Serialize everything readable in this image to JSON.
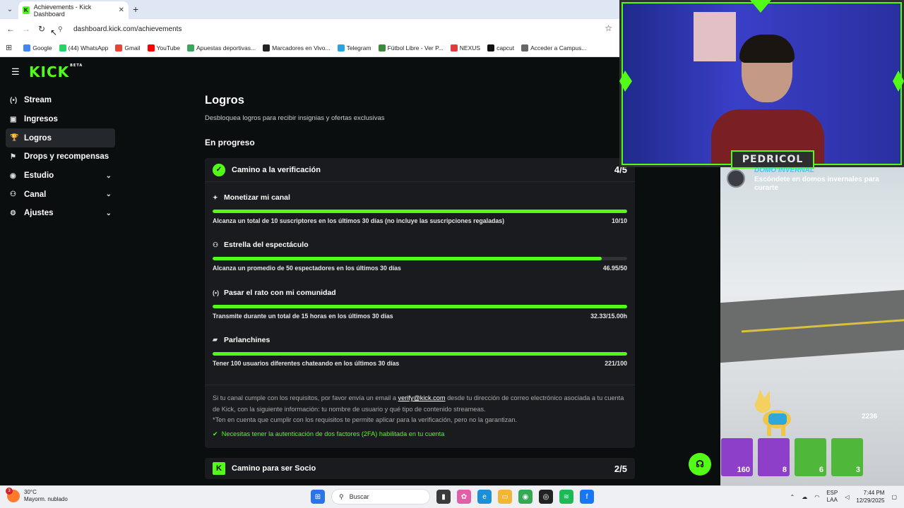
{
  "browser": {
    "tab_title": "Achievements - Kick Dashboard",
    "url": "dashboard.kick.com/achievements",
    "bookmarks": [
      {
        "label": "Google",
        "color": "#4285f4"
      },
      {
        "label": "(44) WhatsApp",
        "color": "#25d366"
      },
      {
        "label": "Gmail",
        "color": "#ea4335"
      },
      {
        "label": "YouTube",
        "color": "#ff0000"
      },
      {
        "label": "Apuestas deportivas...",
        "color": "#3ba55c"
      },
      {
        "label": "Marcadores en Vivo...",
        "color": "#222222"
      },
      {
        "label": "Telegram",
        "color": "#2aa3df"
      },
      {
        "label": "Fútbol Libre - Ver P...",
        "color": "#3b8b3b"
      },
      {
        "label": "NEXUS",
        "color": "#e23b3b"
      },
      {
        "label": "capcut",
        "color": "#111111"
      },
      {
        "label": "Acceder a Campus...",
        "color": "#666666"
      }
    ]
  },
  "kick": {
    "logo": "KICK",
    "logo_badge": "BETA",
    "sidebar": [
      {
        "label": "Stream",
        "icon": "broadcast-icon",
        "glyph": "(•)",
        "expandable": false,
        "active": false
      },
      {
        "label": "Ingresos",
        "icon": "revenue-icon",
        "glyph": "▣",
        "expandable": false,
        "active": false
      },
      {
        "label": "Logros",
        "icon": "trophy-icon",
        "glyph": "🏆",
        "expandable": false,
        "active": true
      },
      {
        "label": "Drops y recompensas",
        "icon": "drops-icon",
        "glyph": "⚑",
        "expandable": false,
        "active": false
      },
      {
        "label": "Estudio",
        "icon": "studio-icon",
        "glyph": "◉",
        "expandable": true,
        "active": false
      },
      {
        "label": "Canal",
        "icon": "channel-icon",
        "glyph": "⚇",
        "expandable": true,
        "active": false
      },
      {
        "label": "Ajustes",
        "icon": "settings-icon",
        "glyph": "⚙",
        "expandable": true,
        "active": false
      }
    ],
    "page_title": "Logros",
    "page_subtitle": "Desbloquea logros para recibir insignias y ofertas exclusivas",
    "section_title": "En progreso",
    "card": {
      "title": "Camino a la verificación",
      "count": "4/5",
      "tasks": [
        {
          "title": "Monetizar mi canal",
          "icon": "sparkle-icon",
          "glyph": "✦",
          "desc": "Alcanza un total de 10 suscriptores en los últimos 30 días (no incluye las suscripciones regaladas)",
          "value": "10/10",
          "progress": 1.0
        },
        {
          "title": "Estrella del espectáculo",
          "icon": "viewers-icon",
          "glyph": "⚇",
          "desc": "Alcanza un promedio de 50 espectadores en los últimos 30 días",
          "value": "46.95/50",
          "progress": 0.939
        },
        {
          "title": "Pasar el rato con mi comunidad",
          "icon": "live-icon",
          "glyph": "(•)",
          "desc": "Transmite durante un total de 15 horas en los últimos 30 días",
          "value": "32.33/15.00h",
          "progress": 1.0
        },
        {
          "title": "Parlanchines",
          "icon": "chat-icon",
          "glyph": "▰",
          "desc": "Tener 100 usuarios diferentes chateando en los últimos 30 días",
          "value": "221/100",
          "progress": 1.0
        }
      ],
      "info_before": "Si tu canal cumple con los requisitos, por favor envía un email a ",
      "info_email": "verify@kick.com",
      "info_after": " desde tu dirección de correo electrónico asociada a tu cuenta de Kick, con la siguiente información: tu nombre de usuario y qué tipo de contenido streameas.",
      "info_note": "*Ten en cuenta que cumplir con los requisitos te permite aplicar para la verificación, pero no la garantizan.",
      "requirement": "Necesitas tener la autenticación de dos factores (2FA) habilitada en tu cuenta"
    },
    "card2": {
      "title": "Camino para ser Socio",
      "count": "2/5"
    }
  },
  "stream_overlay": {
    "streamer_name": "PEDRICOL",
    "quest_title": "DOMO INVERNAL",
    "quest_desc": "Escóndete en domos invernales para curarte",
    "ammo": "2236",
    "slots": [
      {
        "count": "160",
        "color": "#8e3fc9"
      },
      {
        "count": "8",
        "color": "#8e3fc9"
      },
      {
        "count": "6",
        "color": "#4fb83a"
      },
      {
        "count": "3",
        "color": "#4fb83a"
      }
    ]
  },
  "taskbar": {
    "weather_temp": "30°C",
    "weather_desc": "Mayorm. nublado",
    "weather_badge": "3",
    "search_placeholder": "Buscar",
    "lang_top": "ESP",
    "lang_bottom": "LAA",
    "time": "7:44 PM",
    "date": "12/29/2025"
  }
}
